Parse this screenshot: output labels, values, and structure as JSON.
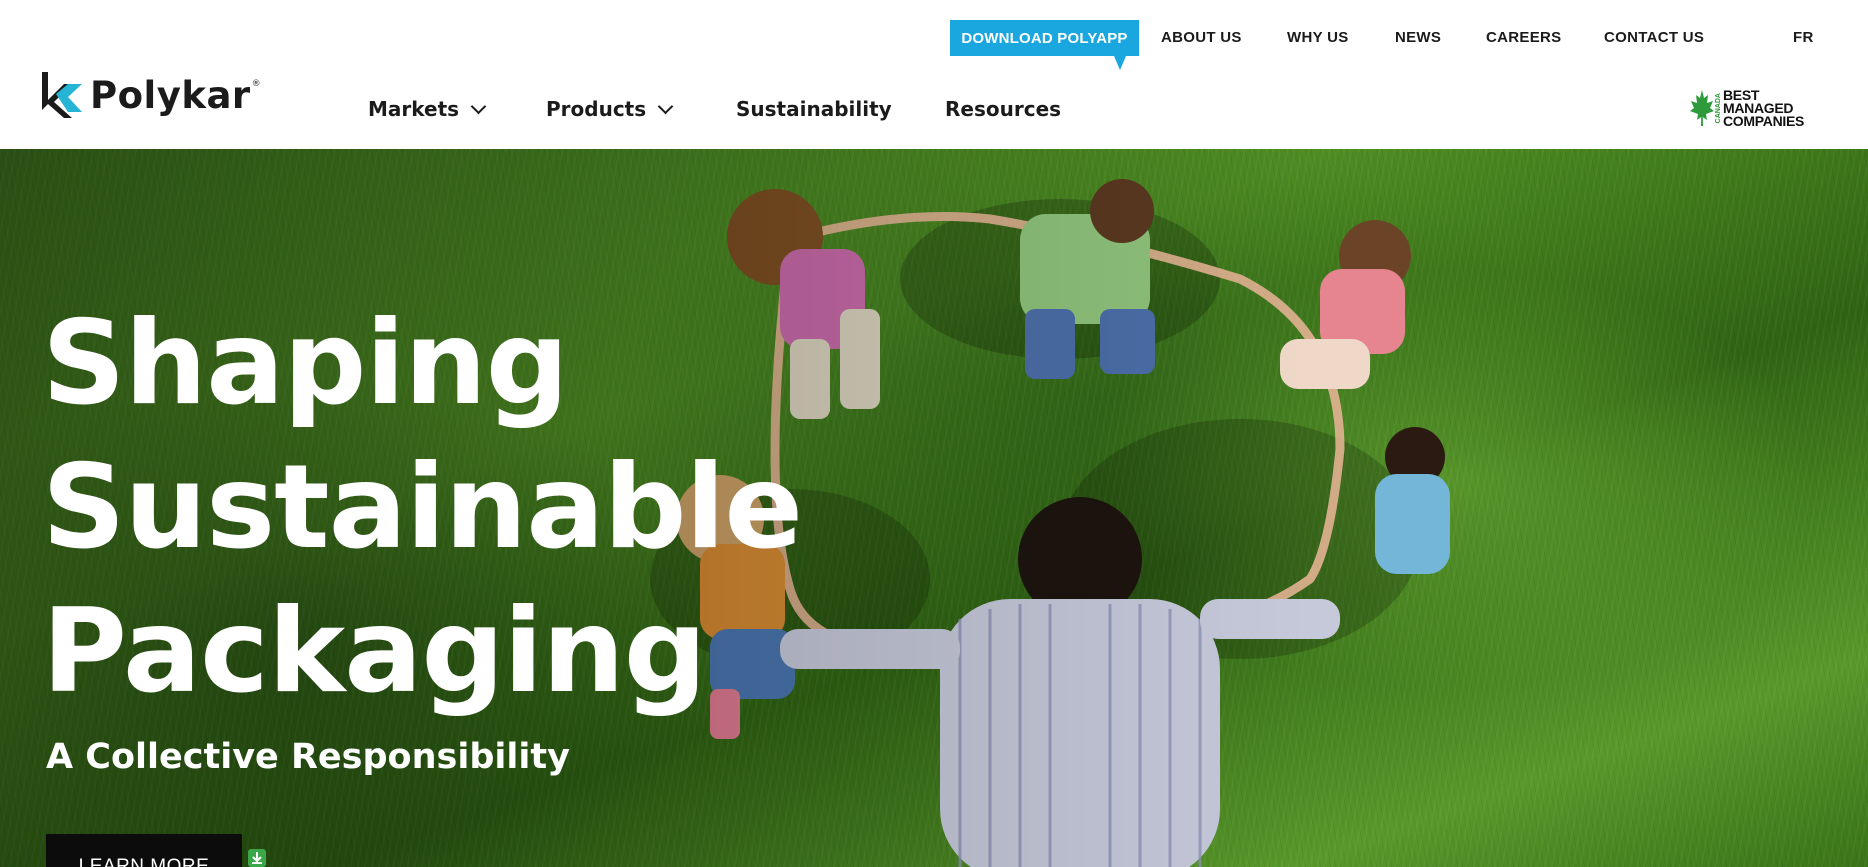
{
  "brand": {
    "name": "Polykar",
    "trademark": "®"
  },
  "top_nav": {
    "download_label": "DOWNLOAD POLYAPP",
    "links": [
      "ABOUT US",
      "WHY US",
      "NEWS",
      "CAREERS",
      "CONTACT US"
    ],
    "language": "FR"
  },
  "main_nav": {
    "markets": "Markets",
    "products": "Products",
    "sustainability": "Sustainability",
    "resources": "Resources"
  },
  "badge": {
    "country": "CANADA",
    "line1": "BEST",
    "line2": "MANAGED",
    "line3": "COMPANIES"
  },
  "hero": {
    "title_line1": "Shaping",
    "title_line2": "Sustainable",
    "title_line3": "Packaging",
    "subtitle": "A Collective Responsibility",
    "cta_label": "LEARN MORE"
  },
  "colors": {
    "accent": "#1aa7e0",
    "logo_teal": "#25b4d6",
    "dark": "#1b1b1b",
    "badge_green": "#2e9a3c"
  },
  "icons": [
    "polykar-logo-icon",
    "chevron-down-icon",
    "maple-leaf-icon",
    "download-arrow-icon"
  ]
}
